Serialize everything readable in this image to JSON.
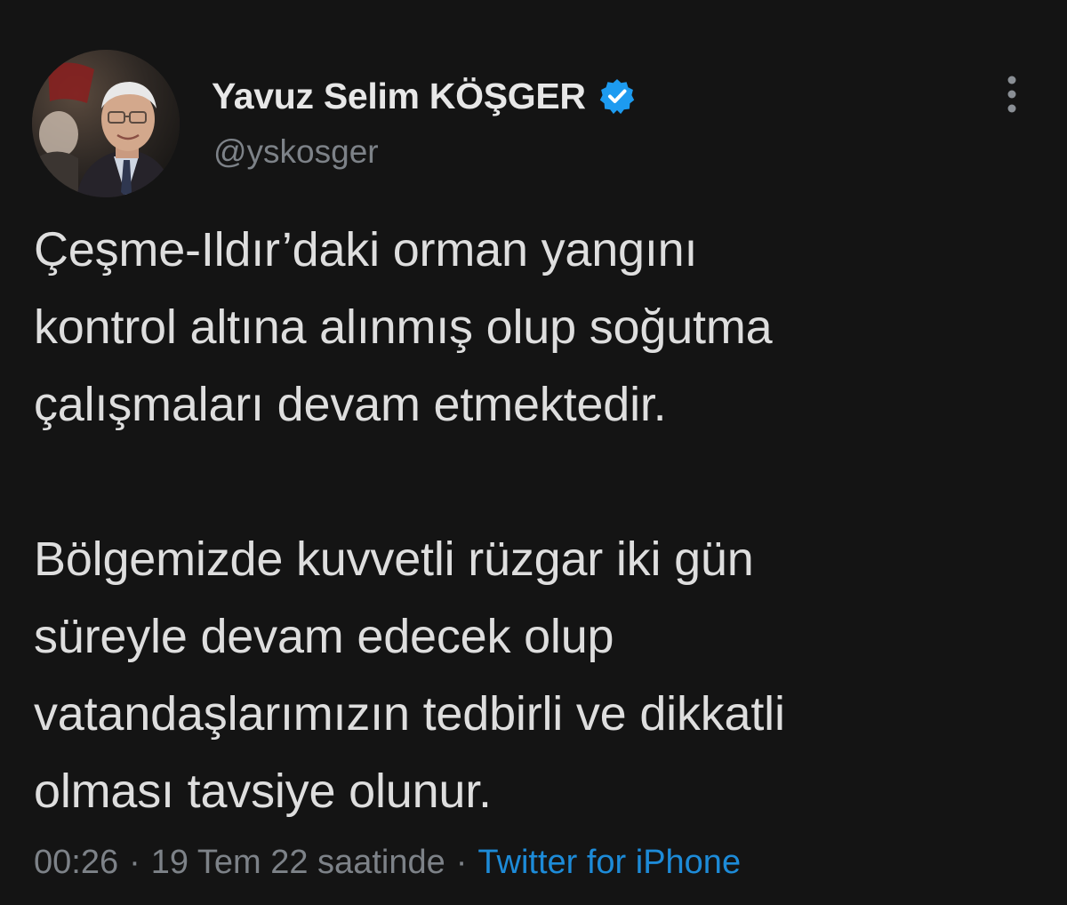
{
  "tweet": {
    "author": {
      "display_name": "Yavuz Selim KÖŞGER",
      "handle": "@yskosger",
      "verified": true,
      "avatar_icon": "profile-photo",
      "verified_icon": "verified-badge-icon"
    },
    "more_icon": "more-vertical-icon",
    "paragraphs": [
      "Çeşme-Ildır’daki  orman yangını\nkontrol altına alınmış olup soğutma\nçalışmaları devam etmektedir.",
      "Bölgemizde kuvvetli rüzgar iki gün\nsüreyle devam edecek olup\nvatandaşlarımızın tedbirli ve dikkatli\nolması tavsiye olunur."
    ],
    "meta": {
      "time": "00:26",
      "separator": "·",
      "date": "19 Tem 22 saatinde",
      "source": "Twitter for iPhone"
    }
  },
  "colors": {
    "background": "#141414",
    "text": "#dedede",
    "muted": "#7d8288",
    "accent": "#1d8bd8",
    "verified": "#1d9bf0"
  }
}
